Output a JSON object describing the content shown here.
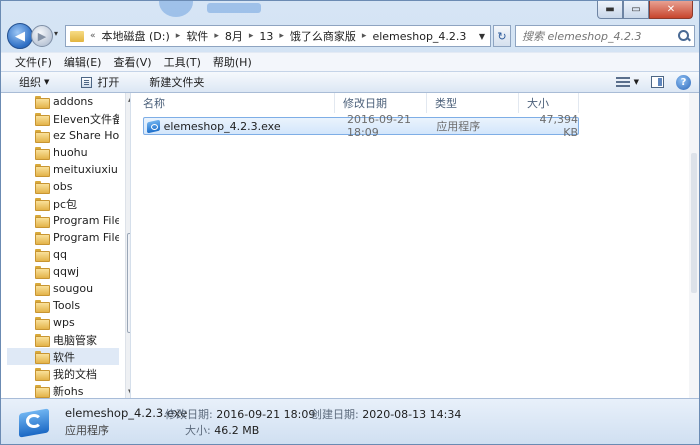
{
  "window": {
    "min_label": "▬",
    "max_label": "▭",
    "close_label": "✕"
  },
  "nav": {
    "back_glyph": "◀",
    "forward_glyph": "▶",
    "history_glyph": "▾",
    "refresh_glyph": "↻",
    "address_overflow": "«",
    "breadcrumb": [
      "本地磁盘 (D:)",
      "软件",
      "8月",
      "13",
      "饿了么商家版",
      "elemeshop_4.2.3"
    ],
    "search_placeholder": "搜索 elemeshop_4.2.3"
  },
  "menubar": {
    "items": [
      "文件(F)",
      "编辑(E)",
      "查看(V)",
      "工具(T)",
      "帮助(H)"
    ]
  },
  "cmdbar": {
    "organize": "组织",
    "open": "打开",
    "new_folder": "新建文件夹",
    "help_glyph": "?"
  },
  "tree": {
    "items": [
      {
        "label": "addons"
      },
      {
        "label": "Eleven文件备份"
      },
      {
        "label": "ez Share Home"
      },
      {
        "label": "huohu"
      },
      {
        "label": "meituxiuxiu"
      },
      {
        "label": "obs"
      },
      {
        "label": "pc包"
      },
      {
        "label": "Program Files"
      },
      {
        "label": "Program Files"
      },
      {
        "label": "qq"
      },
      {
        "label": "qqwj"
      },
      {
        "label": "sougou"
      },
      {
        "label": "Tools"
      },
      {
        "label": "wps"
      },
      {
        "label": "电脑管家"
      },
      {
        "label": "软件"
      },
      {
        "label": "我的文档"
      },
      {
        "label": "新ohs"
      }
    ],
    "selected_index": 15
  },
  "columns": {
    "name": "名称",
    "date": "修改日期",
    "type": "类型",
    "size": "大小"
  },
  "files": [
    {
      "name": "elemeshop_4.2.3.exe",
      "date": "2016-09-21 18:09",
      "type": "应用程序",
      "size": "47,394 KB"
    }
  ],
  "details": {
    "name": "elemeshop_4.2.3.exe",
    "type": "应用程序",
    "modified_label": "修改日期:",
    "modified_value": "2016-09-21 18:09",
    "size_label": "大小:",
    "size_value": "46.2 MB",
    "created_label": "创建日期:",
    "created_value": "2020-08-13 14:34"
  },
  "colors": {
    "selection_border": "#7eaee6",
    "accent_blue": "#2d6ec4"
  }
}
